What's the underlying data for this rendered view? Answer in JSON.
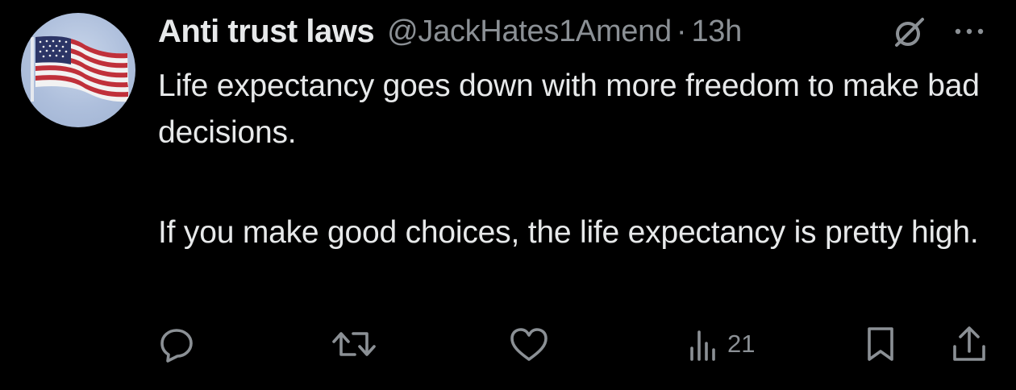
{
  "tweet": {
    "display_name": "Anti trust laws",
    "handle": "@JackHates1Amend",
    "separator": "·",
    "time": "13h",
    "text_paragraphs": [
      "Life expectancy goes down with more freedom to make bad decisions.",
      "If you make good choices, the life expectancy is pretty high."
    ]
  },
  "avatar": {
    "description_icon": "american-flag"
  },
  "actions": {
    "reply_icon": "reply-icon",
    "retweet_icon": "retweet-icon",
    "like_icon": "heart-icon",
    "views_icon": "views-icon",
    "views_count": "21",
    "bookmark_icon": "bookmark-icon",
    "share_icon": "share-icon"
  },
  "colors": {
    "background": "#000000",
    "primary_text": "#e7e9ea",
    "secondary_text": "#8b9095"
  }
}
